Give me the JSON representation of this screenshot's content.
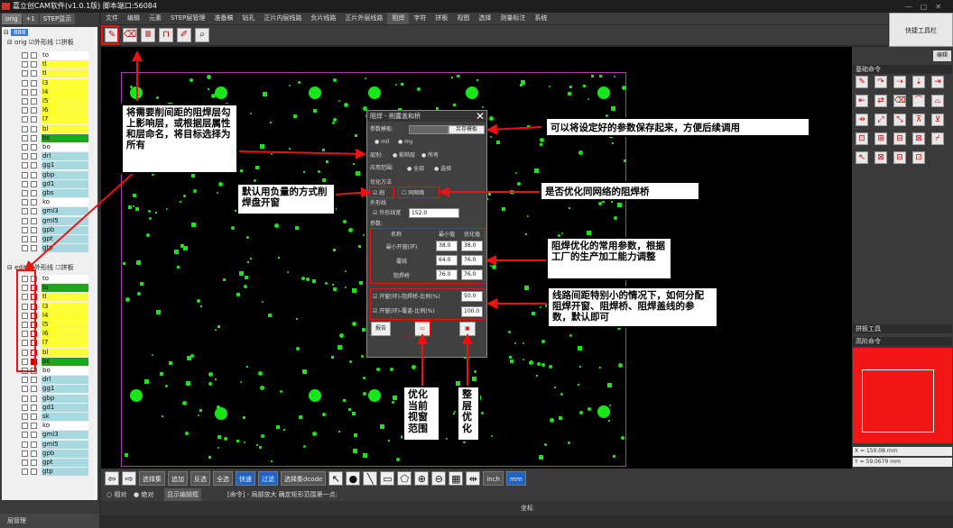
{
  "window": {
    "title": "嘉立创CAM软件(v1.0.1版) 脚本端口:56084"
  },
  "left_tabs": [
    "orig",
    "+1",
    "STEP显示"
  ],
  "tree": {
    "root": "888",
    "orig_label": "orig",
    "edit_label": "edit",
    "outline_label": "外形线",
    "panel_label": "拼板",
    "layers_top": [
      "to",
      "tl",
      "tl",
      "l3",
      "l4",
      "l5",
      "l6",
      "l7",
      "bl",
      "bs",
      "bo",
      "drl",
      "gg1",
      "gbp",
      "gd1",
      "gbs",
      "ko",
      "gml3",
      "gml5",
      "gpb",
      "gpt",
      "gtp"
    ],
    "layers_bottom": [
      "to",
      "ts",
      "tl",
      "l3",
      "l4",
      "l5",
      "l6",
      "l7",
      "bl",
      "bs",
      "bo",
      "drl",
      "gg1",
      "gbp",
      "gd1",
      "sk",
      "ko",
      "gml3",
      "gml5",
      "gpb",
      "gpt",
      "gtp"
    ],
    "layer_manager": "层管理"
  },
  "menu": [
    "文件",
    "编辑",
    "元素",
    "STEP层管理",
    "准备稿",
    "钻孔",
    "正片内层线路",
    "负片线路",
    "正片外层线路",
    "阻焊",
    "字符",
    "拼板",
    "视图",
    "选择",
    "测量标注",
    "系统"
  ],
  "menu_active": "阻焊",
  "quick_toolbar": "快捷工具栏",
  "right_panel": {
    "edit_btn": "编辑",
    "basic_cmd": "基础命令",
    "panel_tool": "拼板工具",
    "advanced_cmd": "高阶命令",
    "coord_x": "X = 150.08 mm",
    "coord_y": "Y = 59.0679 mm"
  },
  "bottom_bar": [
    "选择集",
    "追加",
    "反选",
    "全选",
    "快速",
    "过滤",
    "选择集dcode"
  ],
  "bottom_units": [
    "inch",
    "mm"
  ],
  "status": {
    "relative": "相对",
    "absolute": "绝对",
    "show_edit": "显示编辑框",
    "command": "[命令] - 局部放大  确定矩形范围第一点:"
  },
  "coord_bar": "坐标",
  "dialog": {
    "title": "阻焊 - 削露盖和桥",
    "template_label": "参数模板:",
    "save_template": "另存模板",
    "unit_mil": "mil",
    "unit_my": "my",
    "layer_label": "层别:",
    "layer_opt1": "影响层",
    "layer_opt2": "所有",
    "scope_label": "应用范围:",
    "scope_opt1": "全部",
    "scope_opt2": "选择",
    "opt_method": "优化方法",
    "cut_label": "削",
    "same_net": "同网络",
    "outline_label": "外形线",
    "outline_width_label": "外形线宽",
    "outline_width": "152.0",
    "params_label": "参数:",
    "table_head": [
      "名称",
      "最小值",
      "优化值"
    ],
    "table_rows": [
      {
        "name": "最小开窗(环)",
        "min": "38.0",
        "opt": "38.0"
      },
      {
        "name": "覆线",
        "min": "64.0",
        "opt": "76.0"
      },
      {
        "name": "阻焊桥",
        "min": "76.0",
        "opt": "76.0"
      }
    ],
    "ratio1_label": "开窗(环)-阻焊桥-比例(%)",
    "ratio1": "50.0",
    "ratio2_label": "开窗(环)-覆盖-比例(%)",
    "ratio2": "100.0",
    "report": "报告"
  },
  "callouts": {
    "c1": "将需要削间距的阻焊层勾上影响层，或根据层属性和层命名，将目标选择为所有",
    "c2": "可以将设定好的参数保存起来，方便后续调用",
    "c3": "默认用负量的方式削焊盘开窗",
    "c4": "是否优化同网络的阻焊桥",
    "c5": "阻焊优化的常用参数，根据工厂的生产加工能力调整",
    "c6": "线路间距特别小的情况下，如何分配阻焊开窗、阻焊桥、阻焊盖线的参数，默认即可",
    "c7": "优化当前视窗范围",
    "c8": "整层优化"
  },
  "colors": {
    "canvas": "#000000",
    "copper": "#19e619",
    "outline": "#b03bb0",
    "highlight_red": "#e11111",
    "layer_yellow": "#ffff33",
    "layer_teal": "#a8d8e0",
    "layer_green": "#1fa51f"
  }
}
